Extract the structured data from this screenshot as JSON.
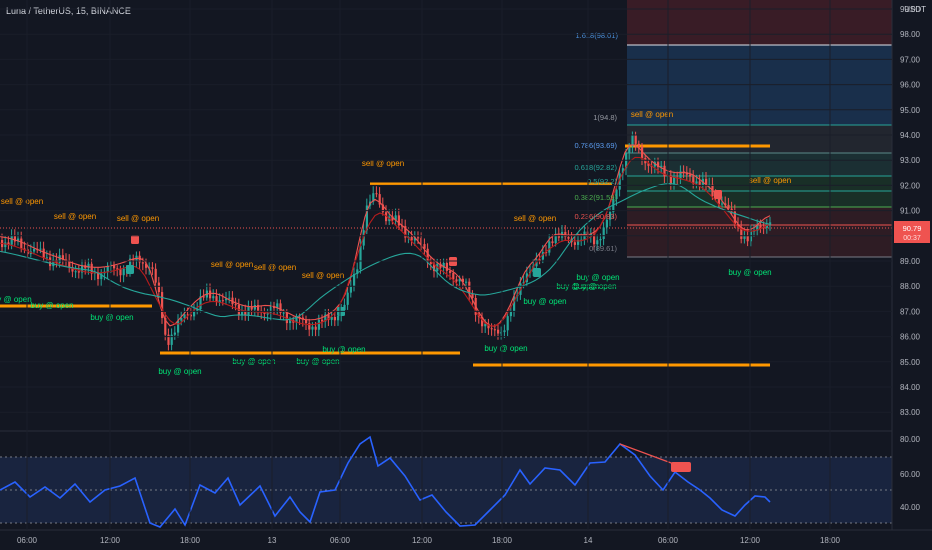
{
  "header": {
    "symbol_line": "Luna / TetherUS, 15, BINANCE",
    "currency": "USDT"
  },
  "price_axis": {
    "ticks": [
      "99.00",
      "98.00",
      "97.00",
      "96.00",
      "95.00",
      "94.00",
      "93.00",
      "92.00",
      "91.00",
      "90.00",
      "89.00",
      "88.00",
      "87.00",
      "86.00",
      "85.00",
      "84.00",
      "83.00"
    ],
    "current_price_label": "90.79",
    "current_countdown_label": "00:37"
  },
  "osc_axis": {
    "ticks": [
      "80.00",
      "60.00",
      "40.00"
    ]
  },
  "time_axis": {
    "ticks": [
      "06:00",
      "12:00",
      "18:00",
      "13",
      "06:00",
      "12:00",
      "18:00",
      "14",
      "06:00",
      "12:00",
      "18:00"
    ]
  },
  "fib_labels": [
    {
      "text": "1.618(98.01)"
    },
    {
      "text": "1(94.8)"
    },
    {
      "text": "0.786(93.69)"
    },
    {
      "text": "0.618(92.82)"
    },
    {
      "text": "0.5(92.2)"
    },
    {
      "text": "0.382(91.59)"
    },
    {
      "text": "0.236(90.83)"
    },
    {
      "text": "0(89.61)"
    }
  ],
  "signals": [
    {
      "text": "sell @ open",
      "type": "sell"
    },
    {
      "text": "sell @ open",
      "type": "sell"
    },
    {
      "text": "sell @ open",
      "type": "sell"
    },
    {
      "text": "sell @ open",
      "type": "sell"
    },
    {
      "text": "sell @ open",
      "type": "sell"
    },
    {
      "text": "sell @ open",
      "type": "sell"
    },
    {
      "text": "sell @ open",
      "type": "sell"
    },
    {
      "text": "sell @ open",
      "type": "sell"
    },
    {
      "text": "sell @ open",
      "type": "sell"
    },
    {
      "text": "sell @ open",
      "type": "sell"
    },
    {
      "text": "buy @ open",
      "type": "buy"
    },
    {
      "text": "buy @ open",
      "type": "buy"
    },
    {
      "text": "buy @ open",
      "type": "buy"
    },
    {
      "text": "buy @ open",
      "type": "buy"
    },
    {
      "text": "buy @ open",
      "type": "buy"
    },
    {
      "text": "buy @ open",
      "type": "buy"
    },
    {
      "text": "buy @ open",
      "type": "buy"
    },
    {
      "text": "buy @ open",
      "type": "buy"
    },
    {
      "text": "buy @ open",
      "type": "buy"
    },
    {
      "text": "buy @ open",
      "type": "buy"
    },
    {
      "text": "buy @ open",
      "type": "buy"
    },
    {
      "text": "buy @ open",
      "type": "buy"
    },
    {
      "text": "buy @ open",
      "type": "buy"
    }
  ],
  "colors": {
    "background": "#131722",
    "up": "#26a69a",
    "down": "#ef5350",
    "sell": "#ff9800",
    "buy": "#00e676",
    "oscillator": "#2962ff",
    "grid": "#1e222d"
  }
}
